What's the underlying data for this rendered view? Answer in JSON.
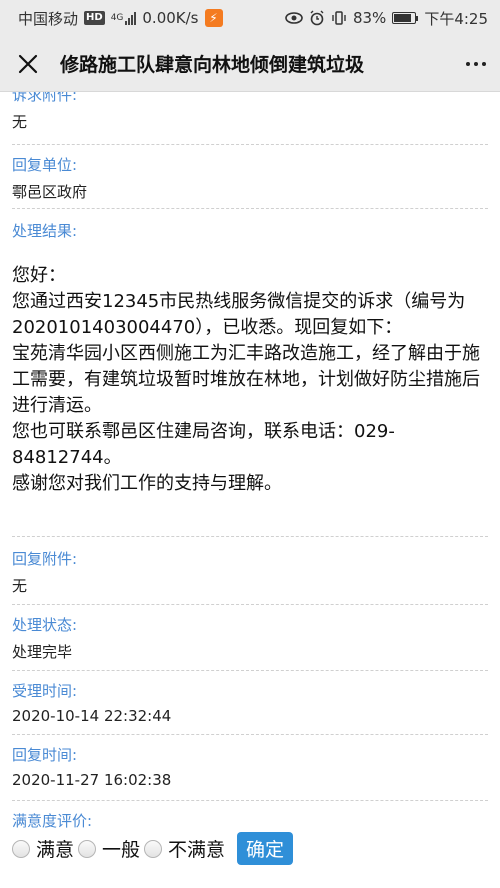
{
  "status_bar": {
    "carrier": "中国移动",
    "hd": "HD",
    "network": "4G",
    "speed": "0.00K/s",
    "battery": "83%",
    "time": "下午4:25"
  },
  "header": {
    "title": "修路施工队肆意向林地倾倒建筑垃圾"
  },
  "fields": {
    "appeal_attachment_label": "诉求附件:",
    "appeal_attachment_value": "无",
    "reply_unit_label": "回复单位:",
    "reply_unit_value": "鄠邑区政府",
    "result_label": "处理结果:",
    "result_lines": [
      "您好：",
      "您通过西安12345市民热线服务微信提交的诉求（编号为2020101403004470），已收悉。现回复如下：",
      "宝苑清华园小区西侧施工为汇丰路改造施工，经了解由于施工需要，有建筑垃圾暂时堆放在林地，计划做好防尘措施后进行清运。",
      "您也可联系鄠邑区住建局咨询，联系电话：029-84812744。",
      "感谢您对我们工作的支持与理解。"
    ],
    "reply_attachment_label": "回复附件:",
    "reply_attachment_value": "无",
    "status_label": "处理状态:",
    "status_value": "处理完毕",
    "accept_time_label": "受理时间:",
    "accept_time_value": "2020-10-14 22:32:44",
    "reply_time_label": "回复时间:",
    "reply_time_value": "2020-11-27 16:02:38",
    "satisfaction_label": "满意度评价:"
  },
  "rating": {
    "options": [
      "满意",
      "一般",
      "不满意"
    ],
    "confirm_label": "确定"
  },
  "colors": {
    "label": "#4a8ad4",
    "button": "#2f8fd8",
    "app_badge": "#f47b20"
  }
}
